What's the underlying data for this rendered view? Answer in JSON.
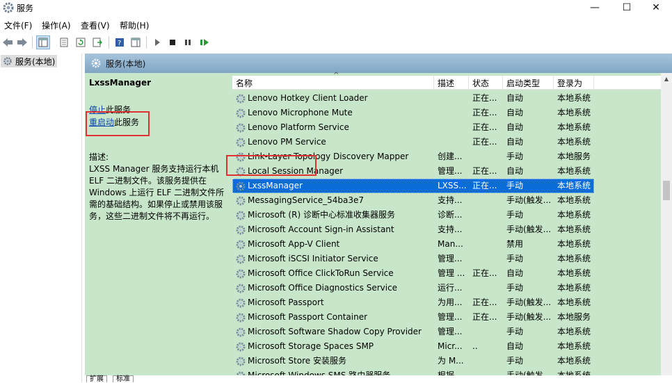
{
  "window": {
    "title": "服务",
    "minimize": "—",
    "maximize": "☐",
    "close": "✕"
  },
  "menu": [
    "文件(F)",
    "操作(A)",
    "查看(V)",
    "帮助(H)"
  ],
  "tree": {
    "root": "服务(本地)"
  },
  "panel": {
    "header": "服务(本地)"
  },
  "details": {
    "name": "LxssManager",
    "stop_prefix": "停止",
    "stop_suffix": "此服务",
    "restart_prefix": "重启动",
    "restart_suffix": "此服务",
    "desc_label": "描述:",
    "desc_text": "LXSS Manager 服务支持运行本机 ELF 二进制文件。该服务提供在 Windows 上运行 ELF 二进制文件所需的基础结构。如果停止或禁用该服务，这些二进制文件将不再运行。"
  },
  "columns": [
    "名称",
    "描述",
    "状态",
    "启动类型",
    "登录为"
  ],
  "rows": [
    {
      "name": "Lenovo Hotkey Client Loader",
      "desc": "",
      "status": "正在...",
      "startup": "自动",
      "logon": "本地系统"
    },
    {
      "name": "Lenovo Microphone Mute",
      "desc": "",
      "status": "正在...",
      "startup": "自动",
      "logon": "本地系统"
    },
    {
      "name": "Lenovo Platform Service",
      "desc": "",
      "status": "正在...",
      "startup": "自动",
      "logon": "本地系统"
    },
    {
      "name": "Lenovo PM Service",
      "desc": "",
      "status": "正在...",
      "startup": "自动",
      "logon": "本地系统"
    },
    {
      "name": "Link-Layer Topology Discovery Mapper",
      "desc": "创建...",
      "status": "",
      "startup": "手动",
      "logon": "本地服务"
    },
    {
      "name": "Local Session Manager",
      "desc": "管理...",
      "status": "正在...",
      "startup": "自动",
      "logon": "本地系统"
    },
    {
      "name": "LxssManager",
      "desc": "LXSS...",
      "status": "正在...",
      "startup": "手动",
      "logon": "本地系统"
    },
    {
      "name": "MessagingService_54ba3e7",
      "desc": "支持...",
      "status": "",
      "startup": "手动(触发...",
      "logon": "本地系统"
    },
    {
      "name": "Microsoft (R) 诊断中心标准收集器服务",
      "desc": "诊断...",
      "status": "",
      "startup": "手动",
      "logon": "本地系统"
    },
    {
      "name": "Microsoft Account Sign-in Assistant",
      "desc": "支持...",
      "status": "",
      "startup": "手动(触发...",
      "logon": "本地系统"
    },
    {
      "name": "Microsoft App-V Client",
      "desc": "Man...",
      "status": "",
      "startup": "禁用",
      "logon": "本地系统"
    },
    {
      "name": "Microsoft iSCSI Initiator Service",
      "desc": "管理...",
      "status": "",
      "startup": "手动",
      "logon": "本地系统"
    },
    {
      "name": "Microsoft Office ClickToRun Service",
      "desc": "管理 ...",
      "status": "正在...",
      "startup": "自动",
      "logon": "本地系统"
    },
    {
      "name": "Microsoft Office Diagnostics Service",
      "desc": "运行...",
      "status": "",
      "startup": "手动",
      "logon": "本地系统"
    },
    {
      "name": "Microsoft Passport",
      "desc": "为用...",
      "status": "正在...",
      "startup": "手动(触发...",
      "logon": "本地系统"
    },
    {
      "name": "Microsoft Passport Container",
      "desc": "管理...",
      "status": "正在...",
      "startup": "手动(触发...",
      "logon": "本地服务"
    },
    {
      "name": "Microsoft Software Shadow Copy Provider",
      "desc": "管理...",
      "status": "",
      "startup": "手动",
      "logon": "本地系统"
    },
    {
      "name": "Microsoft Storage Spaces SMP",
      "desc": "Micr...",
      "status": "..",
      "startup": "自动",
      "logon": "本地系统"
    },
    {
      "name": "Microsoft Store 安装服务",
      "desc": "为 M...",
      "status": "",
      "startup": "手动",
      "logon": "本地系统"
    },
    {
      "name": "Microsoft Windows SMS 路由器服务",
      "desc": "根据...",
      "status": "",
      "startup": "手动(触发...",
      "logon": "本地系统"
    }
  ],
  "selected_index": 6,
  "bottom_tabs": [
    "扩展",
    "标准"
  ],
  "colors": {
    "panel_bg": "#c8e6ca",
    "selection": "#0a6cd6",
    "highlight_box": "#e03232",
    "link": "#0645ad"
  }
}
